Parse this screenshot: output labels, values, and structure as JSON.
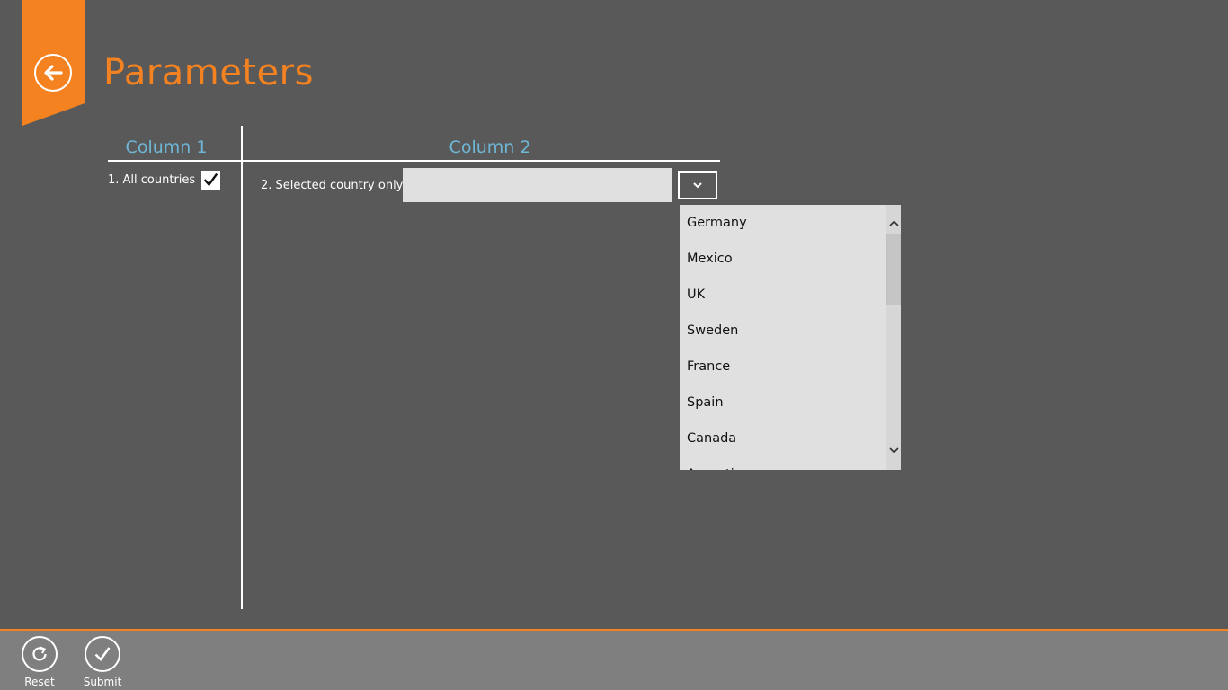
{
  "header": {
    "title": "Parameters",
    "back_icon": "arrow-left-circle-icon"
  },
  "columns": {
    "column1_label": "Column 1",
    "column2_label": "Column 2"
  },
  "parameters": {
    "all_countries_label": "1. All countries",
    "all_countries_checked": true,
    "selected_country_label": "2. Selected country only",
    "selected_country_value": ""
  },
  "dropdown": {
    "items": [
      "Germany",
      "Mexico",
      "UK",
      "Sweden",
      "France",
      "Spain",
      "Canada",
      "Argentina"
    ]
  },
  "appbar": {
    "reset_label": "Reset",
    "submit_label": "Submit"
  },
  "colors": {
    "accent": "#f58220",
    "header_text": "#6fb7d6",
    "background": "#595959",
    "appbar": "#7f7f7f"
  }
}
